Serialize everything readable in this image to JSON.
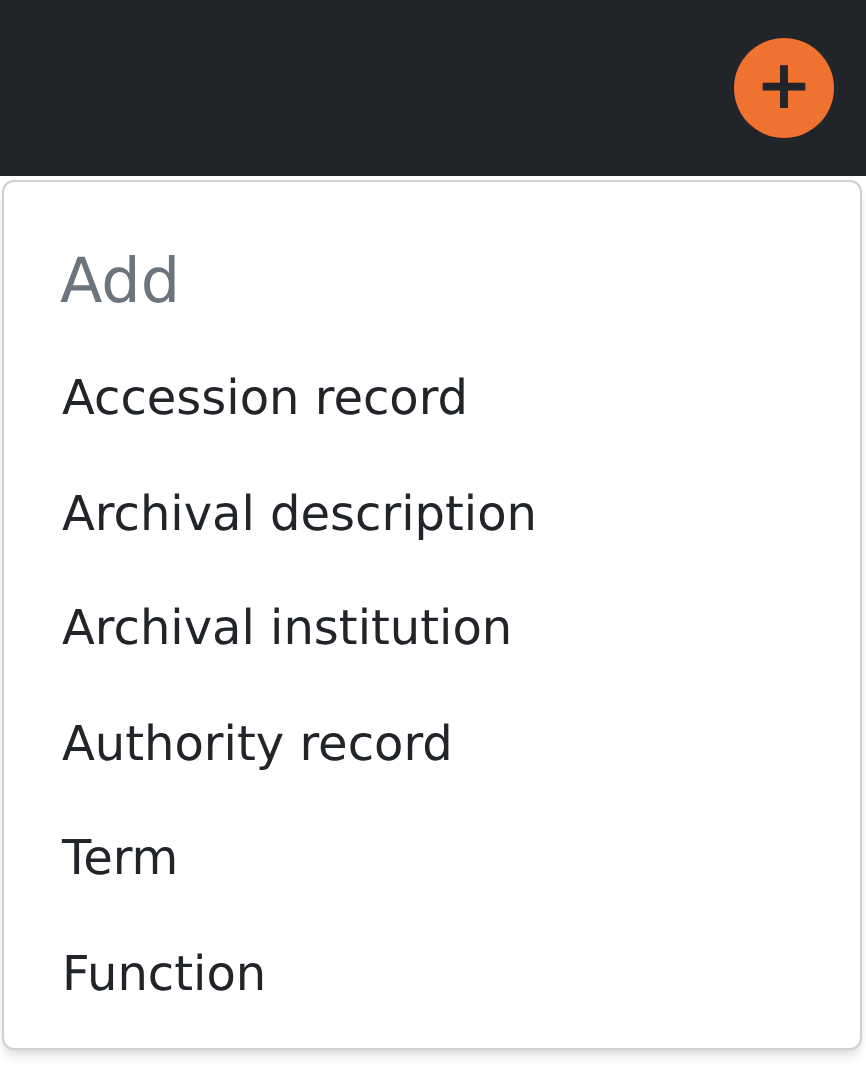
{
  "header": {
    "add_button": {
      "label": "+"
    }
  },
  "menu": {
    "heading": "Add",
    "items": [
      {
        "label": "Accession record"
      },
      {
        "label": "Archival description"
      },
      {
        "label": "Archival institution"
      },
      {
        "label": "Authority record"
      },
      {
        "label": "Term"
      },
      {
        "label": "Function"
      }
    ]
  }
}
